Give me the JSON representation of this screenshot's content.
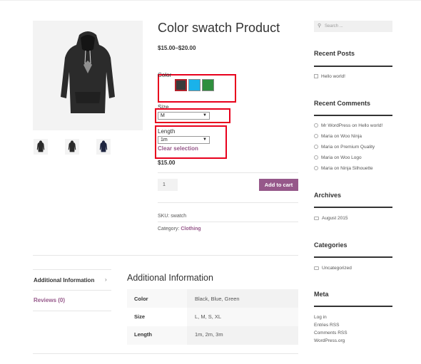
{
  "product": {
    "title": "Color swatch Product",
    "price_range": "$15.00–$20.00",
    "variations": {
      "color_label": "Color",
      "color_swatches": [
        {
          "name": "Black",
          "color": "#3a3a3a",
          "selected": true
        },
        {
          "name": "Blue",
          "color": "#1ab2ea",
          "selected": false
        },
        {
          "name": "Green",
          "color": "#2f8f3e",
          "selected": false
        }
      ],
      "size_label": "Size",
      "size_value": "M",
      "length_label": "Length",
      "length_value": "1m",
      "clear_label": "Clear selection"
    },
    "selected_price": "$15.00",
    "quantity": "1",
    "add_to_cart_label": "Add to cart",
    "sku_label": "SKU:",
    "sku_value": "swatch",
    "category_label": "Category:",
    "category_value": "Clothing",
    "image": "hoodie-image",
    "thumbnails": [
      "hoodie-thumb",
      "hoodie-thumb",
      "hoodie-navy-thumb"
    ]
  },
  "tabs": {
    "items": [
      {
        "label": "Additional Information",
        "active": true
      },
      {
        "label": "Reviews (0)",
        "active": false
      }
    ],
    "chevron": "›",
    "panel_title": "Additional Information",
    "rows": [
      {
        "attribute": "Color",
        "value": "Black, Blue, Green"
      },
      {
        "attribute": "Size",
        "value": "L, M, S, XL"
      },
      {
        "attribute": "Length",
        "value": "1m, 2m, 3m"
      }
    ]
  },
  "sidebar": {
    "search_placeholder": "Search ...",
    "recent_posts_title": "Recent Posts",
    "recent_posts": [
      "Hello world!"
    ],
    "recent_comments_title": "Recent Comments",
    "recent_comments": [
      {
        "author": "Mr WordPress",
        "on": "on",
        "post": "Hello world!"
      },
      {
        "author": "Maria",
        "on": "on",
        "post": "Woo Ninja"
      },
      {
        "author": "Maria",
        "on": "on",
        "post": "Premium Quality"
      },
      {
        "author": "Maria",
        "on": "on",
        "post": "Woo Logo"
      },
      {
        "author": "Maria",
        "on": "on",
        "post": "Ninja Silhouette"
      }
    ],
    "archives_title": "Archives",
    "archives": [
      "August 2015"
    ],
    "categories_title": "Categories",
    "categories": [
      "Uncategorized"
    ],
    "meta_title": "Meta",
    "meta_links": [
      "Log in",
      "Entries RSS",
      "Comments RSS",
      "WordPress.org"
    ]
  },
  "colors": {
    "accent": "#96588a",
    "highlight_box": "#e8001c"
  }
}
